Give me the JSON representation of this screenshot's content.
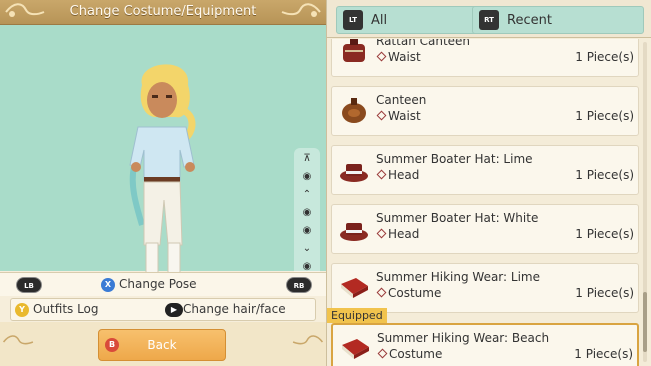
{
  "header": {
    "title": "Change Costume/Equipment"
  },
  "controls": {
    "lb": "LB",
    "rb": "RB",
    "x_glyph": "X",
    "change_pose": "Change Pose",
    "y_glyph": "Y",
    "outfits_log": "Outfits Log",
    "change_hair_face": "Change hair/face"
  },
  "back": {
    "b_glyph": "B",
    "label": "Back"
  },
  "tabs": [
    {
      "badge": "LT",
      "label": "All"
    },
    {
      "badge": "RT",
      "label": "Recent"
    }
  ],
  "items": [
    {
      "name": "Rattan Canteen",
      "slot": "Waist",
      "qty": "1 Piece(s)",
      "icon": "canteen-icon"
    },
    {
      "name": "Canteen",
      "slot": "Waist",
      "qty": "1 Piece(s)",
      "icon": "canteen-icon"
    },
    {
      "name": "Summer Boater Hat: Lime",
      "slot": "Head",
      "qty": "1 Piece(s)",
      "icon": "hat-icon"
    },
    {
      "name": "Summer Boater Hat: White",
      "slot": "Head",
      "qty": "1 Piece(s)",
      "icon": "hat-icon"
    },
    {
      "name": "Summer Hiking Wear: Lime",
      "slot": "Costume",
      "qty": "1 Piece(s)",
      "icon": "book-icon"
    },
    {
      "name": "Summer Hiking Wear: Beach",
      "slot": "Costume",
      "qty": "1 Piece(s)",
      "icon": "book-icon"
    }
  ],
  "equipped_label": "Equipped",
  "colors": {
    "accent": "#f1c34d",
    "preview_bg": "#a9dcc9",
    "tab_bg": "#b7dfd2",
    "back_btn": "#eea84a"
  }
}
